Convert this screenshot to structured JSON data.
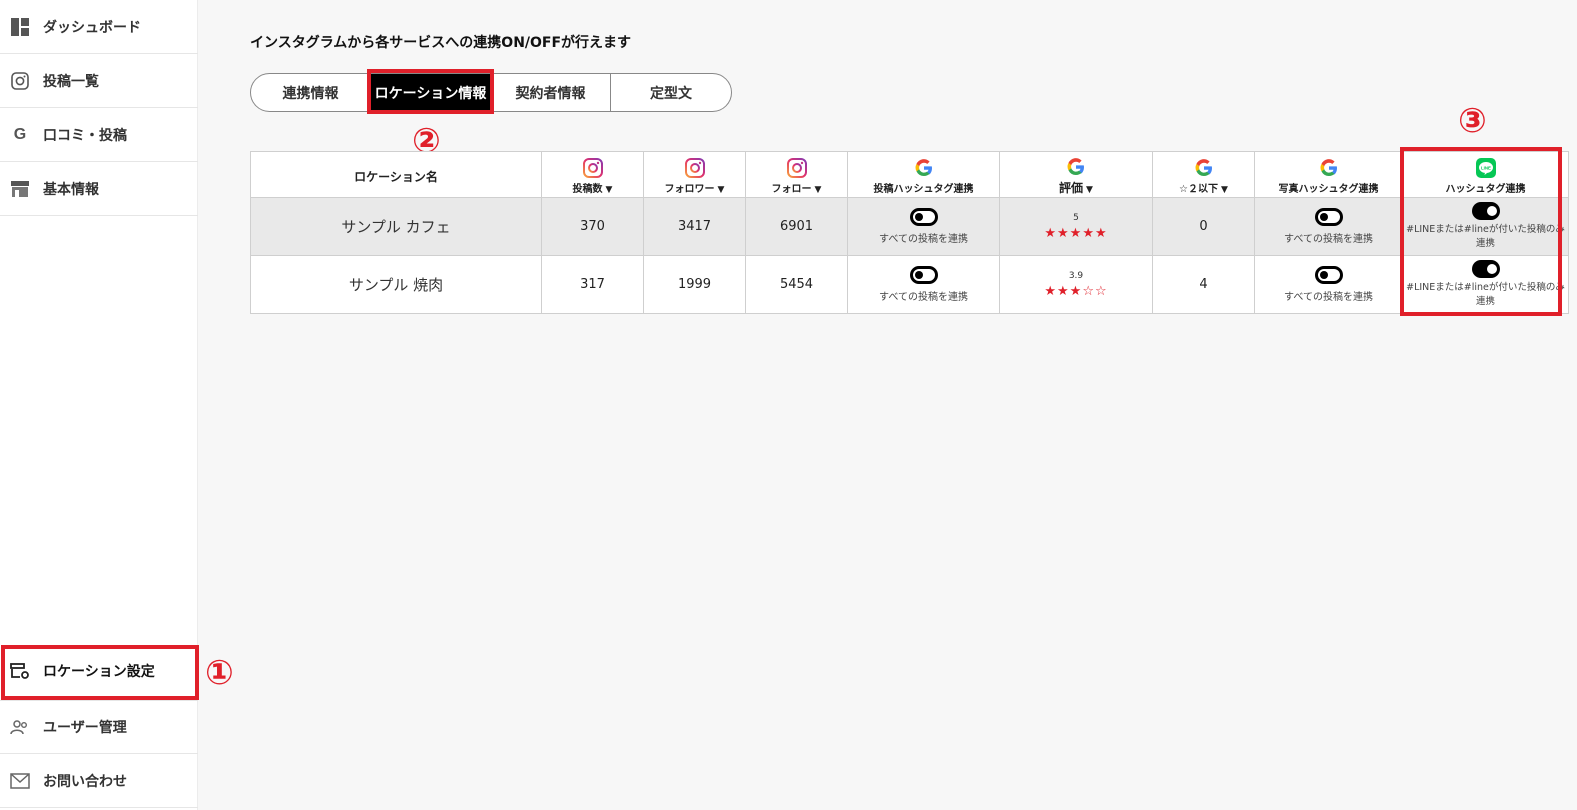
{
  "sidebar": {
    "items": [
      {
        "label": "ダッシュボード",
        "icon": "dashboard-icon"
      },
      {
        "label": "投稿一覧",
        "icon": "instagram-icon"
      },
      {
        "label": "口コミ・投稿",
        "icon": "google-icon"
      },
      {
        "label": "基本情報",
        "icon": "store-icon"
      },
      {
        "label": "ロケーション設定",
        "icon": "location-settings-icon"
      },
      {
        "label": "ユーザー管理",
        "icon": "users-icon"
      },
      {
        "label": "お問い合わせ",
        "icon": "mail-icon"
      }
    ]
  },
  "main": {
    "description": "インスタグラムから各サービスへの連携ON/OFFが行えます",
    "tabs": [
      {
        "label": "連携情報"
      },
      {
        "label": "ロケーション情報"
      },
      {
        "label": "契約者情報"
      },
      {
        "label": "定型文"
      }
    ]
  },
  "table": {
    "headers": {
      "location": "ロケーション名",
      "posts": "投稿数",
      "followers": "フォロワー",
      "following": "フォロー",
      "post_hashtag": "投稿ハッシュタグ連携",
      "rating": "評価",
      "low_rating": "☆２以下",
      "photo_hashtag": "写真ハッシュタグ連携",
      "line_hashtag": "ハッシュタグ連携"
    },
    "caret": "▼",
    "rows": [
      {
        "name": "サンプル カフェ",
        "posts": "370",
        "followers": "3417",
        "following": "6901",
        "post_hashtag_label": "すべての投稿を連携",
        "rating_value": "5",
        "stars": "★★★★★",
        "rating_number": 5.0,
        "low_rating": "0",
        "photo_hashtag_label": "すべての投稿を連携",
        "line_label": "#LINEまたは#lineが付いた投稿のみ連携",
        "post_hashtag_on": false,
        "photo_hashtag_on": false,
        "line_on": true
      },
      {
        "name": "サンプル 焼肉",
        "posts": "317",
        "followers": "1999",
        "following": "5454",
        "post_hashtag_label": "すべての投稿を連携",
        "rating_value": "3.9",
        "stars": "★★★☆☆",
        "rating_number": 3.9,
        "low_rating": "4",
        "photo_hashtag_label": "すべての投稿を連携",
        "line_label": "#LINEまたは#lineが付いた投稿のみ連携",
        "post_hashtag_on": false,
        "photo_hashtag_on": false,
        "line_on": true
      }
    ]
  },
  "annotations": [
    "①",
    "②",
    "③"
  ],
  "colors": {
    "annotation": "#e0202a",
    "active_tab": "#000000",
    "line_green": "#06c755"
  }
}
